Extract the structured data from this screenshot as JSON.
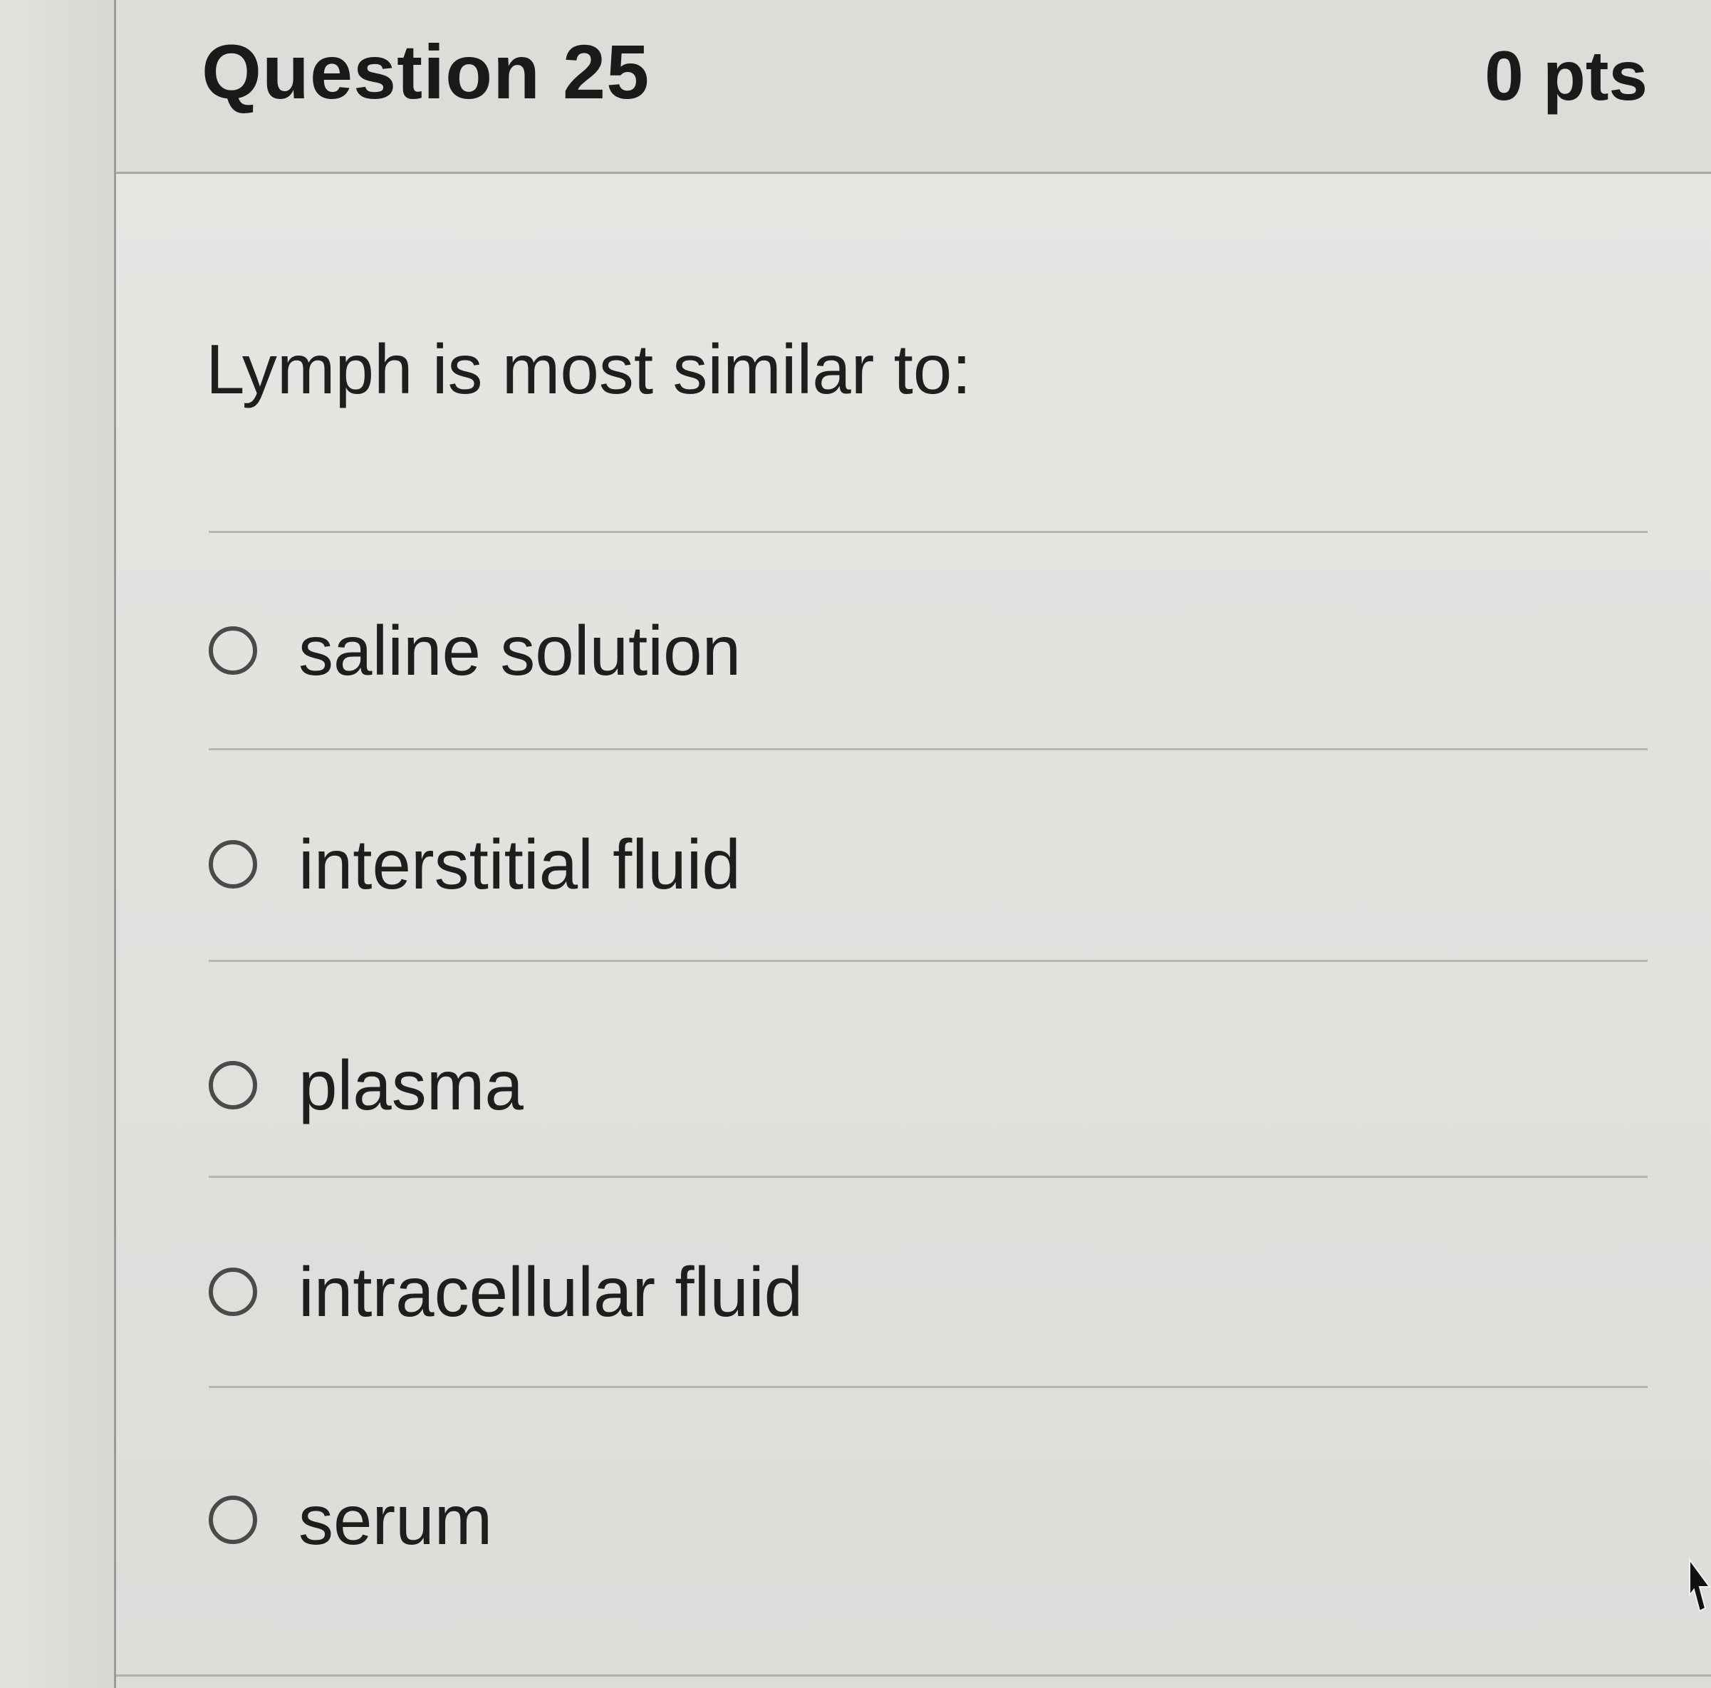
{
  "question": {
    "title": "Question 25",
    "points": "0 pts",
    "prompt": "Lymph is most similar to:",
    "answers": [
      {
        "label": "saline solution",
        "selected": false
      },
      {
        "label": "interstitial fluid",
        "selected": false
      },
      {
        "label": "plasma",
        "selected": false
      },
      {
        "label": "intracellular fluid",
        "selected": false
      },
      {
        "label": "serum",
        "selected": false
      }
    ]
  },
  "icons": {
    "radio": "radio-unselected-icon",
    "cursor": "mouse-pointer-icon"
  }
}
